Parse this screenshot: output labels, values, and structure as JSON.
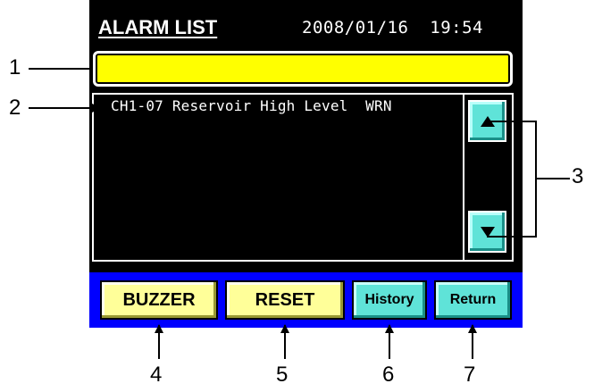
{
  "screen": {
    "title": "ALARM LIST",
    "datetime": "2008/01/16  19:54",
    "status_bar_color": "#ffff00",
    "alarm_entries": [
      "CH1-07 Reservoir High Level  WRN"
    ]
  },
  "scroll": {
    "up_icon": "triangle-up-icon",
    "down_icon": "triangle-down-icon",
    "color": "#5fe3d8"
  },
  "buttons": {
    "buzzer": "BUZZER",
    "reset": "RESET",
    "history": "History",
    "return": "Return"
  },
  "callouts": {
    "c1": "1",
    "c2": "2",
    "c3": "3",
    "c4": "4",
    "c5": "5",
    "c6": "6",
    "c7": "7"
  },
  "colors": {
    "button_bar": "#0000ff",
    "yellow_button": "#ffff99",
    "cyan_button": "#5fe3d8"
  }
}
